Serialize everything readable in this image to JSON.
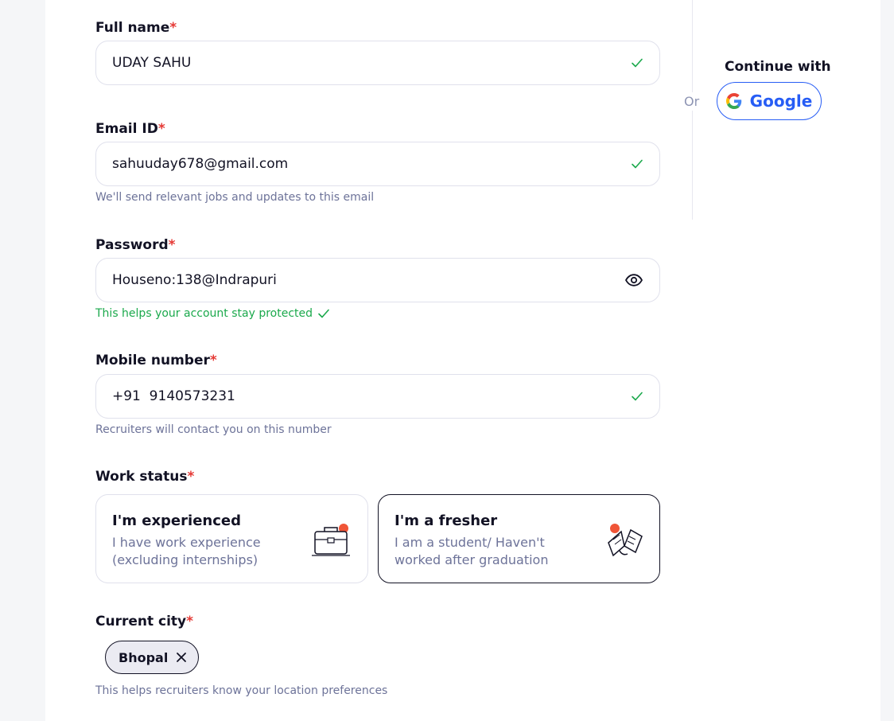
{
  "form": {
    "full_name": {
      "label": "Full name",
      "required_mark": "*",
      "value": "UDAY SAHU"
    },
    "email": {
      "label": "Email ID",
      "required_mark": "*",
      "value": "sahuuday678@gmail.com",
      "hint": "We'll send relevant jobs and updates to this email"
    },
    "password": {
      "label": "Password",
      "required_mark": "*",
      "value": "Houseno:138@Indrapuri",
      "hint": "This helps your account stay protected"
    },
    "mobile": {
      "label": "Mobile number",
      "required_mark": "*",
      "value": "+91  9140573231",
      "hint": "Recruiters will contact you on this number"
    },
    "work_status": {
      "label": "Work status",
      "required_mark": "*",
      "options": [
        {
          "title": "I'm experienced",
          "desc": "I have work experience (excluding internships)",
          "selected": false
        },
        {
          "title": "I'm a fresher",
          "desc": "I am a student/ Haven't worked after graduation",
          "selected": true
        }
      ]
    },
    "city": {
      "label": "Current city",
      "required_mark": "*",
      "chip": "Bhopal",
      "hint": "This helps recruiters know your location preferences"
    }
  },
  "sidebar": {
    "or": "Or",
    "continue_with": "Continue with",
    "google_label": "Google"
  },
  "colors": {
    "accent": "#275df5",
    "success": "#1ba94c",
    "required": "#e53935",
    "muted": "#6d7399"
  }
}
